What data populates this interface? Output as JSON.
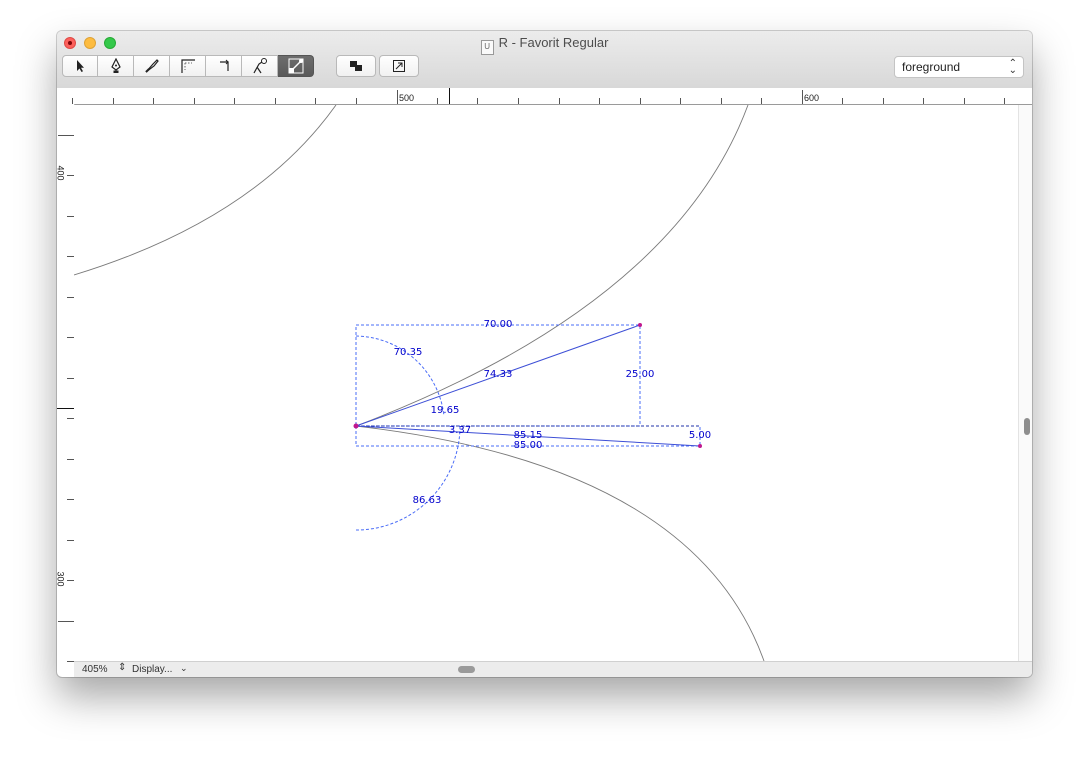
{
  "window": {
    "title": "R - Favorit Regular",
    "doc_icon_glyph": "U"
  },
  "toolbar": {
    "tools": [
      {
        "name": "pointer-tool",
        "icon": "arrow-pointer-icon"
      },
      {
        "name": "pen-tool",
        "icon": "pen-nib-icon"
      },
      {
        "name": "knife-tool",
        "icon": "knife-icon"
      },
      {
        "name": "metrics-tool",
        "icon": "metrics-corner-icon"
      },
      {
        "name": "corner-tool",
        "icon": "corner-icon"
      },
      {
        "name": "anchor-tool",
        "icon": "anchor-curve-icon"
      },
      {
        "name": "measure-tool",
        "icon": "measure-icon",
        "active": true
      }
    ],
    "extra_buttons": [
      {
        "name": "layers-button",
        "icon": "layers-icon"
      },
      {
        "name": "export-button",
        "icon": "box-arrow-icon"
      }
    ],
    "layer_select": {
      "value": "foreground"
    }
  },
  "ruler": {
    "top_labels": [
      "500",
      "600"
    ],
    "left_labels": [
      "400",
      "300"
    ]
  },
  "measurements": {
    "top_width": "70.00",
    "angle_top": "70.35",
    "hypotenuse_upper": "74.33",
    "height_right": "25.00",
    "angle_middle": "19.65",
    "angle_small": "3.37",
    "hypotenuse_lower": "85.15",
    "bottom_width": "85.00",
    "height_small": "5.00",
    "angle_bottom": "86.63"
  },
  "status": {
    "zoom": "405%",
    "display": "Display..."
  },
  "colors": {
    "measure_blue": "#0000cc",
    "measure_line": "#4a6cf7",
    "point_magenta": "#c0188f",
    "outline_gray": "#7a7a7a"
  }
}
